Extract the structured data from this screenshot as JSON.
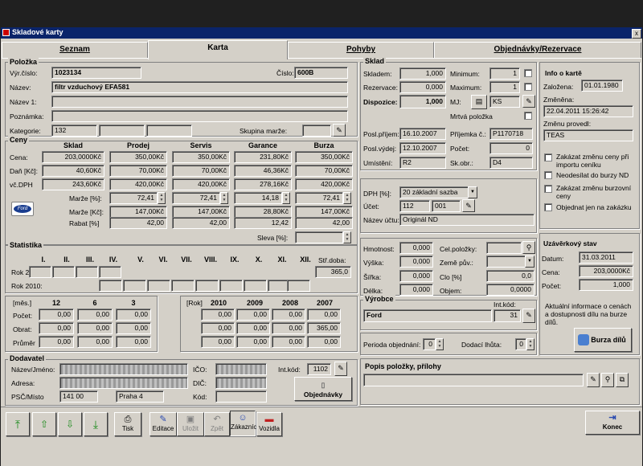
{
  "window": {
    "title": "Skladové karty",
    "close": "x"
  },
  "tabs": [
    {
      "label": "Seznam"
    },
    {
      "label": "Karta"
    },
    {
      "label": "Pohyby"
    },
    {
      "label": "Objednávky/Rezervace"
    }
  ],
  "polozka": {
    "title": "Položka",
    "vyr_cislo_label": "Výr.číslo:",
    "vyr_cislo": "1023134",
    "cislo_label": "Číslo:",
    "cislo": "600B",
    "nazev_label": "Název:",
    "nazev": "filtr vzduchový EFA581",
    "nazev1_label": "Název 1:",
    "poznamka_label": "Poznámka:",
    "kategorie_label": "Kategorie:",
    "kategorie": "132",
    "skupina_marze_label": "Skupina marže:"
  },
  "ceny": {
    "title": "Ceny",
    "cols": [
      "Sklad",
      "Prodej",
      "Servis",
      "Garance",
      "Burza"
    ],
    "rows": [
      {
        "label": "Cena:",
        "values": [
          "203,0000Kč",
          "350,00Kč",
          "350,00Kč",
          "231,80Kč",
          "350,00Kč"
        ]
      },
      {
        "label": "Daň [Kč]:",
        "values": [
          "40,60Kč",
          "70,00Kč",
          "70,00Kč",
          "46,36Kč",
          "70,00Kč"
        ]
      },
      {
        "label": "vč.DPH",
        "values": [
          "243,60Kč",
          "420,00Kč",
          "420,00Kč",
          "278,16Kč",
          "420,00Kč"
        ]
      }
    ],
    "marze_pct_label": "Marže [%]:",
    "marze_pct": [
      "72,41",
      "72,41",
      "14,18",
      "72,41"
    ],
    "marze_kc_label": "Marže [Kč]:",
    "marze_kc": [
      "147,00Kč",
      "147,00Kč",
      "28,80Kč",
      "147,00Kč"
    ],
    "rabat_label": "Rabat [%]",
    "rabat": [
      "42,00",
      "42,00",
      "12,42",
      "42,00"
    ],
    "sleva_label": "Sleva [%]:",
    "brand": "Ford"
  },
  "statistika": {
    "title": "Statistika",
    "months": [
      "I.",
      "II.",
      "III.",
      "IV.",
      "V.",
      "VI.",
      "VII.",
      "VIII.",
      "IX.",
      "X.",
      "XI.",
      "XII."
    ],
    "str_doba_label": "Stř.doba:",
    "str_doba": "365,0",
    "rok2_label": "Rok 2",
    "rok2010_label": "Rok 2010:"
  },
  "mes": {
    "label": "[měs.]",
    "cols": [
      "12",
      "6",
      "3"
    ],
    "rows": [
      {
        "label": "Počet:",
        "values": [
          "0,00",
          "0,00",
          "0,00"
        ]
      },
      {
        "label": "Obrat:",
        "values": [
          "0,00",
          "0,00",
          "0,00"
        ]
      },
      {
        "label": "Průměr",
        "values": [
          "0,00",
          "0,00",
          "0,00"
        ]
      }
    ]
  },
  "rok": {
    "label": "[Rok]",
    "cols": [
      "2010",
      "2009",
      "2008",
      "2007"
    ],
    "rows": [
      {
        "values": [
          "0,00",
          "0,00",
          "0,00",
          "0,00"
        ]
      },
      {
        "values": [
          "0,00",
          "0,00",
          "0,00",
          "365,00"
        ]
      },
      {
        "values": [
          "0,00",
          "0,00",
          "0,00",
          "0,00"
        ]
      }
    ]
  },
  "dodavatel": {
    "title": "Dodavatel",
    "nazev_label": "Název/Jméno:",
    "adresa_label": "Adresa:",
    "psc_label": "PSČ/Místo",
    "psc": "141 00",
    "misto": "Praha 4",
    "ico_label": "IČO:",
    "dic_label": "DIČ:",
    "kod_label": "Kód:",
    "intkod_label": "Int.kód:",
    "intkod": "1102",
    "objednavky": "Objednávky"
  },
  "sklad": {
    "title": "Sklad",
    "skladem_label": "Skladem:",
    "skladem": "1,000",
    "rezervace_label": "Rezervace:",
    "rezervace": "0,000",
    "dispozice_label": "Dispozice:",
    "dispozice": "1,000",
    "minimum_label": "Minimum:",
    "minimum": "1",
    "maximum_label": "Maximum:",
    "maximum": "1",
    "mj_label": "MJ:",
    "mj": "KS",
    "mrtva_label": "Mrtvá položka",
    "posl_prijem_label": "Posl.příjem:",
    "posl_prijem": "16.10.2007",
    "posl_vydej_label": "Posl.výdej:",
    "posl_vydej": "12.10.2007",
    "umisteni_label": "Umístění:",
    "umisteni": "R2",
    "prijemka_label": "Příjemka č.:",
    "prijemka": "P1170718",
    "pocet_label": "Počet:",
    "pocet": "0",
    "skobr_label": "Sk.obr.:",
    "skobr": "D4"
  },
  "dph": {
    "dph_label": "DPH [%]:",
    "dph": "20 základní sazba",
    "ucet_label": "Účet:",
    "ucet1": "112",
    "ucet2": "001",
    "nazev_uctu_label": "Název účtu:",
    "nazev_uctu": "Originál ND"
  },
  "rozmery": {
    "hmotnost_label": "Hmotnost:",
    "hmotnost": "0,000",
    "vyska_label": "Výška:",
    "vyska": "0,000",
    "sirka_label": "Šířka:",
    "sirka": "0,000",
    "delka_label": "Délka:",
    "delka": "0,000",
    "celpoloz_label": "Cel.položky:",
    "zeme_label": "Země pův.:",
    "clo_label": "Clo [%]",
    "clo": "0,0",
    "objem_label": "Objem:",
    "objem": "0,0000"
  },
  "vyrobce": {
    "title": "Výrobce",
    "intkod_label": "Int.kód:",
    "name": "Ford",
    "intkod": "31"
  },
  "objednani": {
    "perioda_label": "Perioda objednání:",
    "perioda": "0",
    "lhuta_label": "Dodací lhůta:",
    "lhuta": "0"
  },
  "info": {
    "title": "Info o kartě",
    "zalozena_label": "Založena:",
    "zalozena": "01.01.1980",
    "zmenena_label": "Změněna:",
    "zmenena": "22.04.2011 15:26:42",
    "zmenu_label": "Změnu provedl:",
    "zmenu": "TEAS",
    "checks": [
      "Zakázat změnu ceny při importu ceníku",
      "Neodesílat do burzy ND",
      "Zakázat změnu burzovní ceny",
      "Objednat jen na zakázku"
    ]
  },
  "uzaverka": {
    "title": "Uzávěrkový stav",
    "datum_label": "Datum:",
    "datum": "31.03.2011",
    "cena_label": "Cena:",
    "cena": "203,0000Kč",
    "pocet_label": "Počet:",
    "pocet": "1,000",
    "note": "Aktuální informace o cenách a dostupnosti dílu na burze dílů.",
    "burza": "Burza dílů"
  },
  "popis": {
    "title": "Popis položky, přílohy"
  },
  "toolbar": {
    "tisk": "Tisk",
    "editace": "Editace",
    "ulozit": "Uložit",
    "zpet": "Zpět",
    "zakaznici": "Zákazníci",
    "vozidla": "Vozidla",
    "konec": "Konec"
  }
}
